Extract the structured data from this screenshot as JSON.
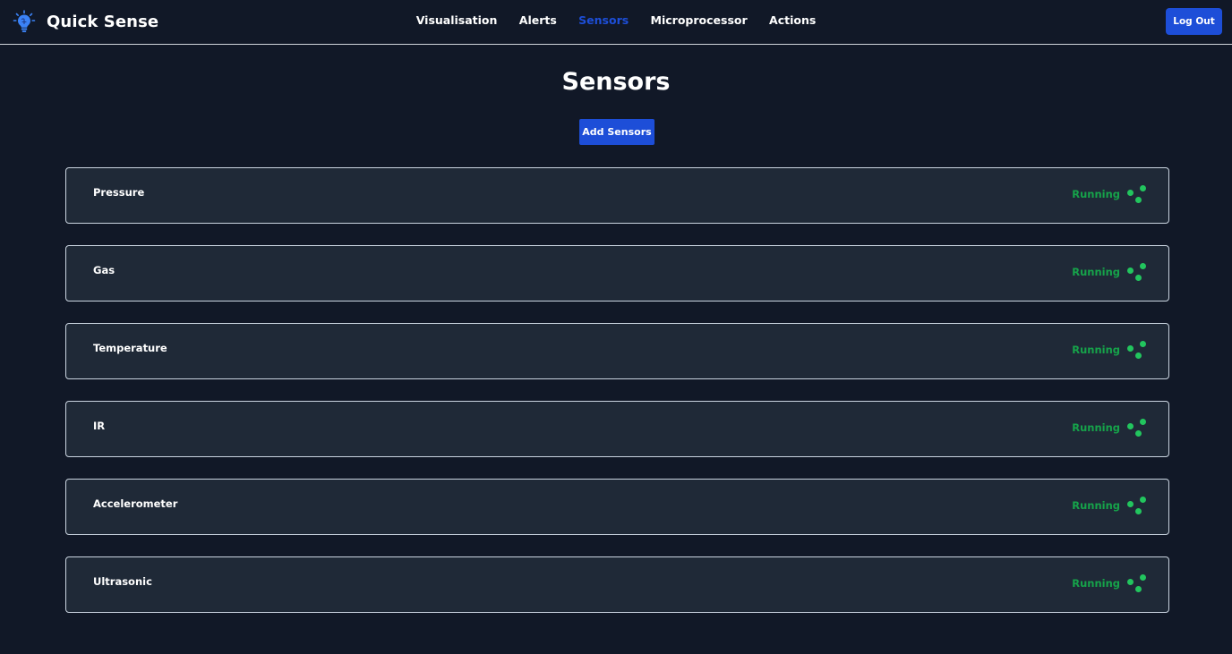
{
  "header": {
    "brand_title": "Quick Sense",
    "logo_icon": "lightbulb-brain-icon",
    "nav": [
      {
        "label": "Visualisation",
        "active": false
      },
      {
        "label": "Alerts",
        "active": false
      },
      {
        "label": "Sensors",
        "active": true
      },
      {
        "label": "Microprocessor",
        "active": false
      },
      {
        "label": "Actions",
        "active": false
      }
    ],
    "logout_label": "Log Out"
  },
  "main": {
    "title": "Sensors",
    "add_button_label": "Add Sensors",
    "sensors": [
      {
        "name": "Pressure",
        "status": "Running"
      },
      {
        "name": "Gas",
        "status": "Running"
      },
      {
        "name": "Temperature",
        "status": "Running"
      },
      {
        "name": "IR",
        "status": "Running"
      },
      {
        "name": "Accelerometer",
        "status": "Running"
      },
      {
        "name": "Ultrasonic",
        "status": "Running"
      }
    ]
  },
  "colors": {
    "background": "#111827",
    "card_background": "#1f2937",
    "accent": "#1d4ed8",
    "status_running": "#16a34a"
  }
}
